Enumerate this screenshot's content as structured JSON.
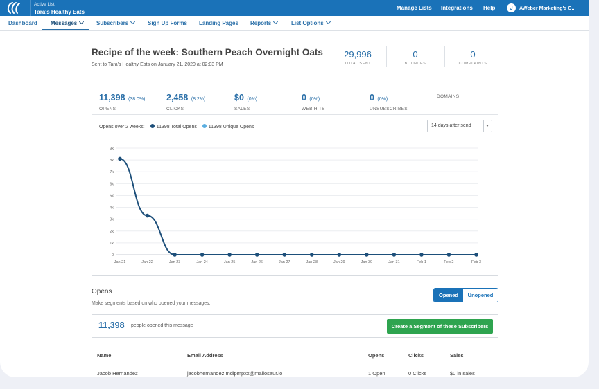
{
  "topbar": {
    "active_list_label": "Active List:",
    "active_list_name": "Tara's Healthy Eats",
    "nav": [
      "Manage Lists",
      "Integrations",
      "Help"
    ],
    "account_name": "AWeber Marketing's C..."
  },
  "subnav": {
    "items": [
      {
        "label": "Dashboard"
      },
      {
        "label": "Messages"
      },
      {
        "label": "Subscribers"
      },
      {
        "label": "Sign Up Forms"
      },
      {
        "label": "Landing Pages"
      },
      {
        "label": "Reports"
      },
      {
        "label": "List Options"
      }
    ]
  },
  "message": {
    "title": "Recipe of the week: Southern Peach Overnight Oats",
    "sent_prefix": "Sent to ",
    "list_name": "Tara's Healthy Eats",
    "sent_on": " on ",
    "date": "January 21, 2020 at 02:03 PM"
  },
  "stats": [
    {
      "value": "29,996",
      "label": "TOTAL SENT"
    },
    {
      "value": "0",
      "label": "BOUNCES"
    },
    {
      "value": "0",
      "label": "COMPLAINTS"
    }
  ],
  "metrics": [
    {
      "value": "11,398",
      "pct": "(38.0%)",
      "label": "OPENS"
    },
    {
      "value": "2,458",
      "pct": "(8.2%)",
      "label": "CLICKS"
    },
    {
      "value": "$0",
      "pct": "(0%)",
      "label": "SALES"
    },
    {
      "value": "0",
      "pct": "(0%)",
      "label": "WEB HITS"
    },
    {
      "value": "0",
      "pct": "(0%)",
      "label": "UNSUBSCRIBES"
    },
    {
      "value": "",
      "pct": "",
      "label": "DOMAINS"
    }
  ],
  "legend": {
    "title": "Opens over 2 weeks:",
    "total": "11398 Total Opens",
    "unique": "11398 Unique Opens",
    "total_color": "#1d4f7a",
    "unique_color": "#5aaee0"
  },
  "range_select": {
    "value": "14 days after send"
  },
  "chart_data": {
    "type": "line",
    "x": [
      "Jan 21",
      "Jan 22",
      "Jan 23",
      "Jan 24",
      "Jan 25",
      "Jan 26",
      "Jan 27",
      "Jan 28",
      "Jan 29",
      "Jan 30",
      "Jan 31",
      "Feb 1",
      "Feb 2",
      "Feb 3"
    ],
    "y_ticks": [
      "0",
      "1k",
      "2k",
      "3k",
      "4k",
      "5k",
      "6k",
      "7k",
      "8k",
      "9k"
    ],
    "ylim": [
      0,
      9000
    ],
    "series": [
      {
        "values": [
          8100,
          3300,
          0,
          0,
          0,
          0,
          0,
          0,
          0,
          0,
          0,
          0,
          0,
          0
        ],
        "color": "#1d4f7a"
      }
    ],
    "grid": true
  },
  "opens": {
    "heading": "Opens",
    "subtext": "Make segments based on who opened your messages.",
    "toggle": {
      "opened": "Opened",
      "unopened": "Unopened"
    },
    "count": "11,398",
    "count_text": "people opened this message",
    "segment_button": "Create a Segment of these Subscribers"
  },
  "table": {
    "headers": [
      "Name",
      "Email Address",
      "Opens",
      "Clicks",
      "Sales"
    ],
    "rows": [
      [
        "Jacob Hernandez",
        "jacobhernandez.mdlpmpxx@mailosaur.io",
        "1 Open",
        "0 Clicks",
        "$0 in sales"
      ]
    ]
  }
}
